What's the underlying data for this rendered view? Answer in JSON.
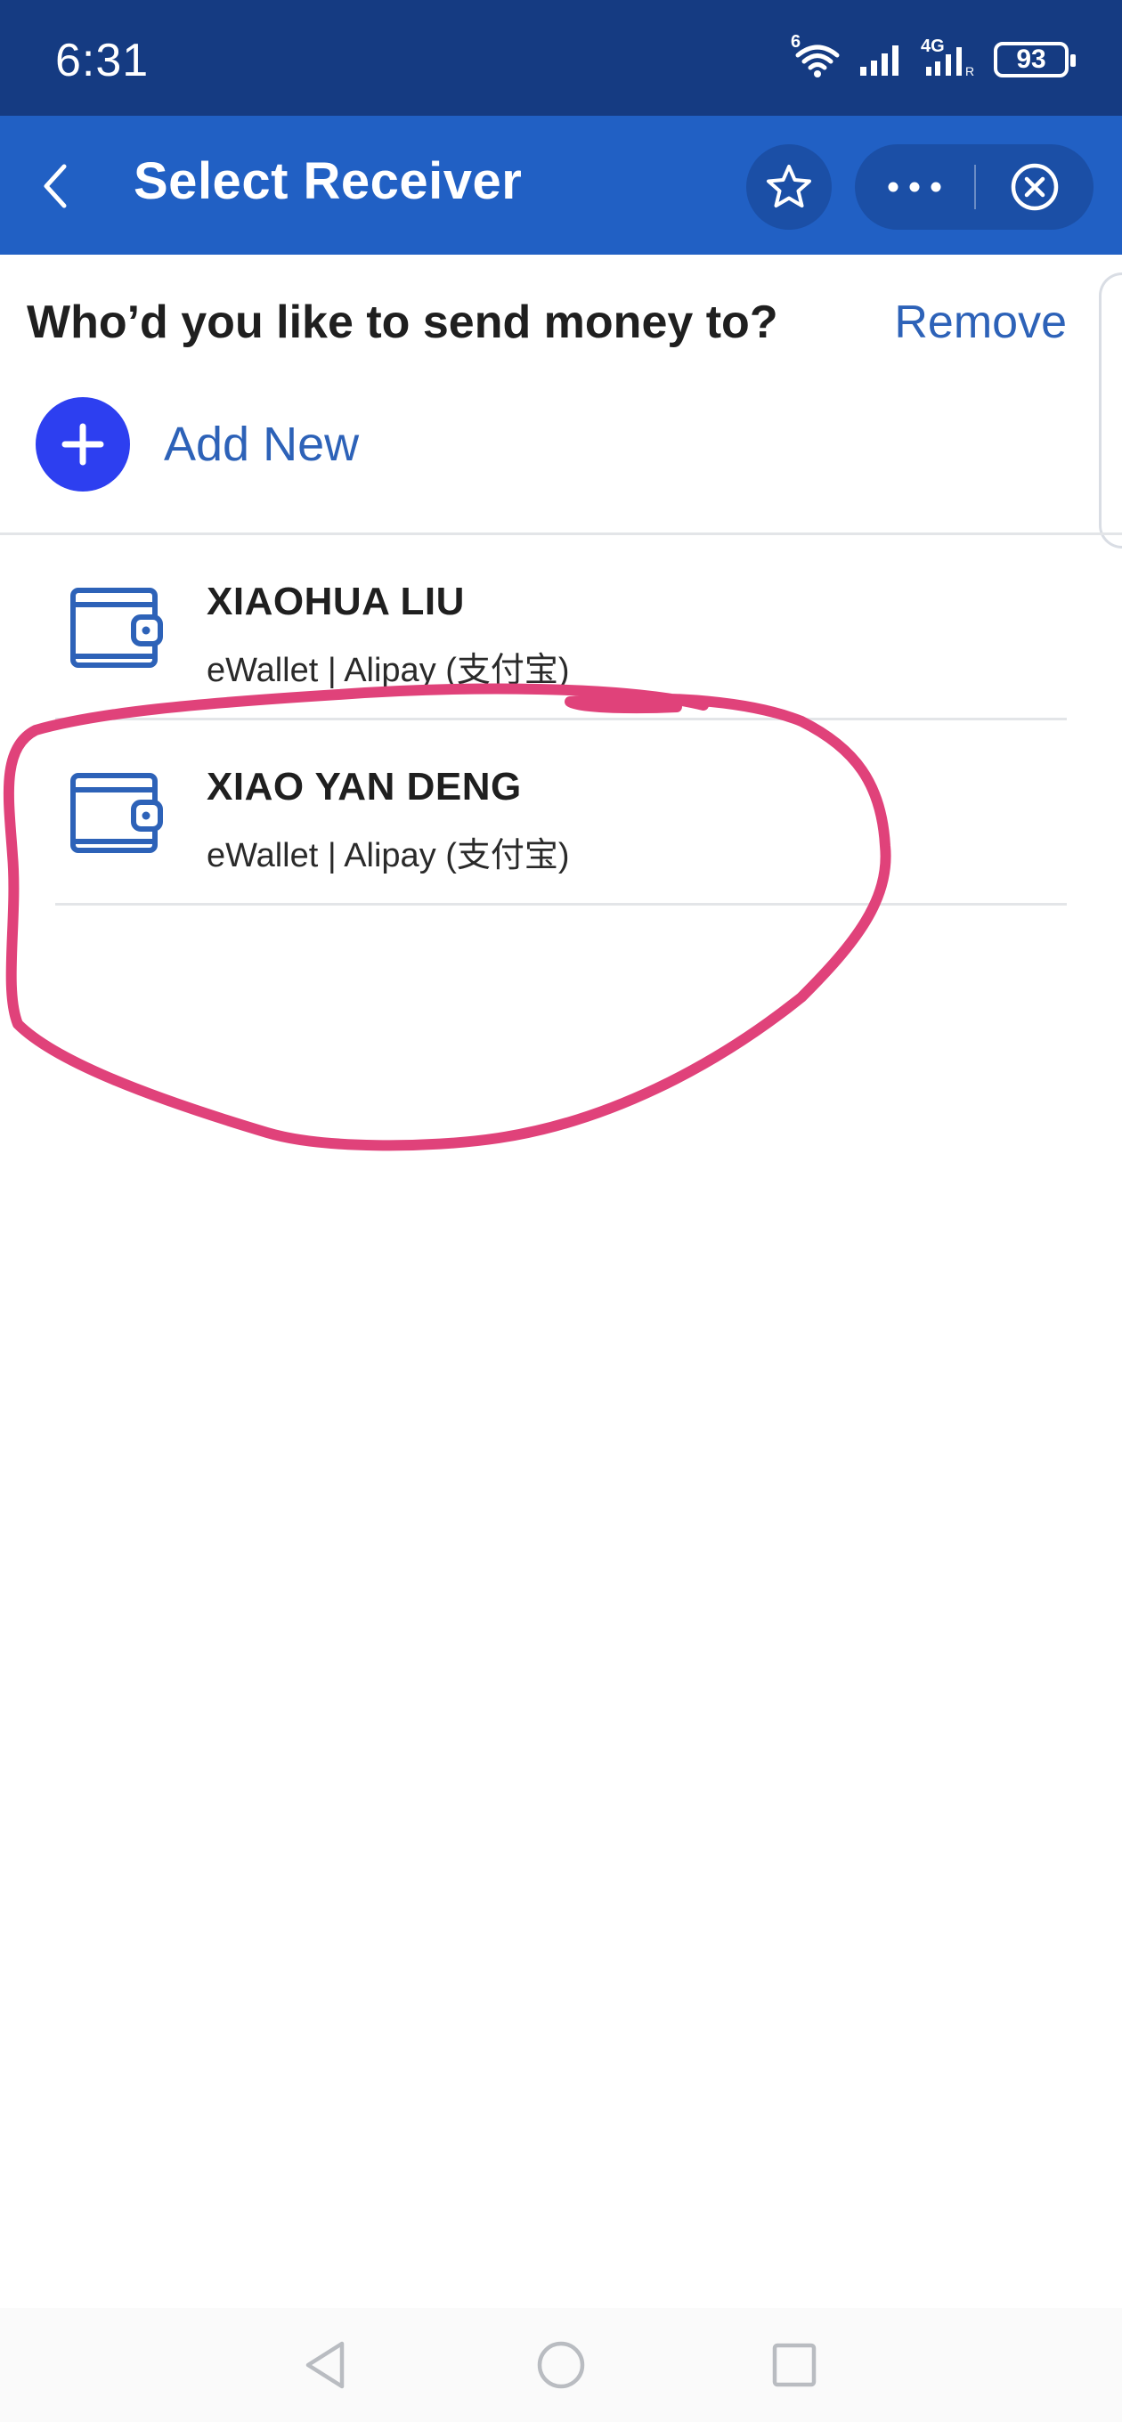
{
  "status_bar": {
    "time": "6:31",
    "network_label": "4G",
    "wifi_label": "6",
    "battery_level": "93"
  },
  "header": {
    "title": "Select Receiver"
  },
  "content": {
    "prompt": "Who’d you like to send money to?",
    "remove_label": "Remove",
    "add_new_label": "Add New"
  },
  "receivers": [
    {
      "name": "XIAOHUA LIU",
      "detail": "eWallet | Alipay (支付宝)"
    },
    {
      "name": "XIAO YAN DENG",
      "detail": "eWallet | Alipay (支付宝)"
    }
  ],
  "colors": {
    "status_bar": "#153b82",
    "header": "#2160c4",
    "accent_link": "#2d62b8",
    "add_button": "#2d3ff0",
    "annotation": "#e0427a"
  },
  "icons": {
    "back": "chevron-left-icon",
    "star": "star-icon",
    "more": "more-dots-icon",
    "close": "close-circle-icon",
    "add": "plus-icon",
    "wallet": "wallet-icon"
  }
}
